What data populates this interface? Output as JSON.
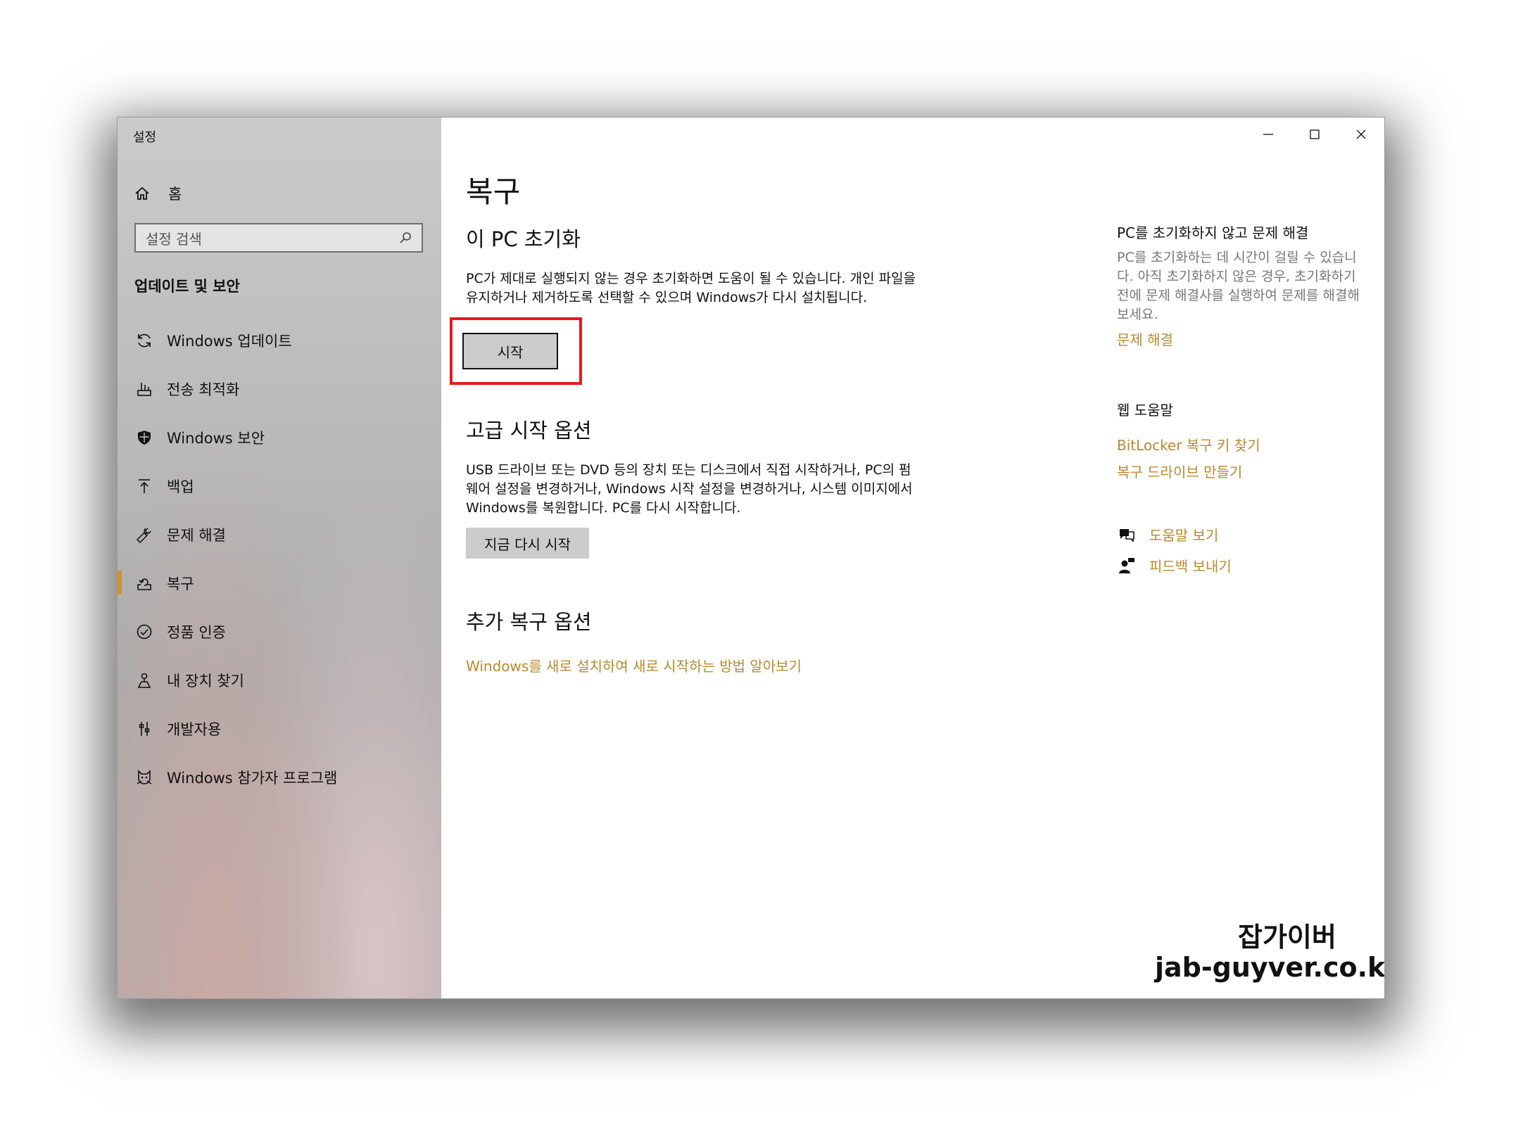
{
  "window": {
    "title": "설정"
  },
  "sidebar": {
    "home_label": "홈",
    "search_placeholder": "설정 검색",
    "section_title": "업데이트 및 보안",
    "items": [
      {
        "label": "Windows 업데이트",
        "icon": "refresh-icon"
      },
      {
        "label": "전송 최적화",
        "icon": "delivery-optimization-icon"
      },
      {
        "label": "Windows 보안",
        "icon": "shield-icon"
      },
      {
        "label": "백업",
        "icon": "backup-arrow-icon"
      },
      {
        "label": "문제 해결",
        "icon": "wrench-icon"
      },
      {
        "label": "복구",
        "icon": "recovery-icon",
        "active": true
      },
      {
        "label": "정품 인증",
        "icon": "check-circle-icon"
      },
      {
        "label": "내 장치 찾기",
        "icon": "find-device-icon"
      },
      {
        "label": "개발자용",
        "icon": "developer-tools-icon"
      },
      {
        "label": "Windows 참가자 프로그램",
        "icon": "insider-cat-icon"
      }
    ]
  },
  "main": {
    "title": "복구",
    "reset": {
      "heading": "이 PC 초기화",
      "description": "PC가 제대로 실행되지 않는 경우 초기화하면 도움이 될 수 있습니다. 개인 파일을 유지하거나 제거하도록 선택할 수 있으며 Windows가 다시 설치됩니다.",
      "button": "시작"
    },
    "advanced": {
      "heading": "고급 시작 옵션",
      "description": "USB 드라이브 또는 DVD 등의 장치 또는 디스크에서 직접 시작하거나, PC의 펌웨어 설정을 변경하거나, Windows 시작 설정을 변경하거나, 시스템 이미지에서 Windows를 복원합니다. PC를 다시 시작합니다.",
      "button": "지금 다시 시작"
    },
    "more": {
      "heading": "추가 복구 옵션",
      "link": "Windows를 새로 설치하여 새로 시작하는 방법 알아보기"
    }
  },
  "right_panel": {
    "troubleshoot": {
      "heading": "PC를 초기화하지 않고 문제 해결",
      "description": "PC를 초기화하는 데 시간이 걸릴 수 있습니다. 아직 초기화하지 않은 경우, 초기화하기 전에 문제 해결사를 실행하여 문제를 해결해 보세요.",
      "link": "문제 해결"
    },
    "web_help": {
      "heading": "웹 도움말",
      "links": [
        "BitLocker 복구 키 찾기",
        "복구 드라이브 만들기"
      ]
    },
    "help": {
      "get_help": "도움말 보기",
      "feedback": "피드백 보내기"
    }
  },
  "watermark": {
    "name": "잡가이버",
    "url": "jab-guyver.co.kr"
  },
  "colors": {
    "accent": "#b9892f",
    "highlight": "#e8181f",
    "active_indicator": "#d4902a"
  }
}
